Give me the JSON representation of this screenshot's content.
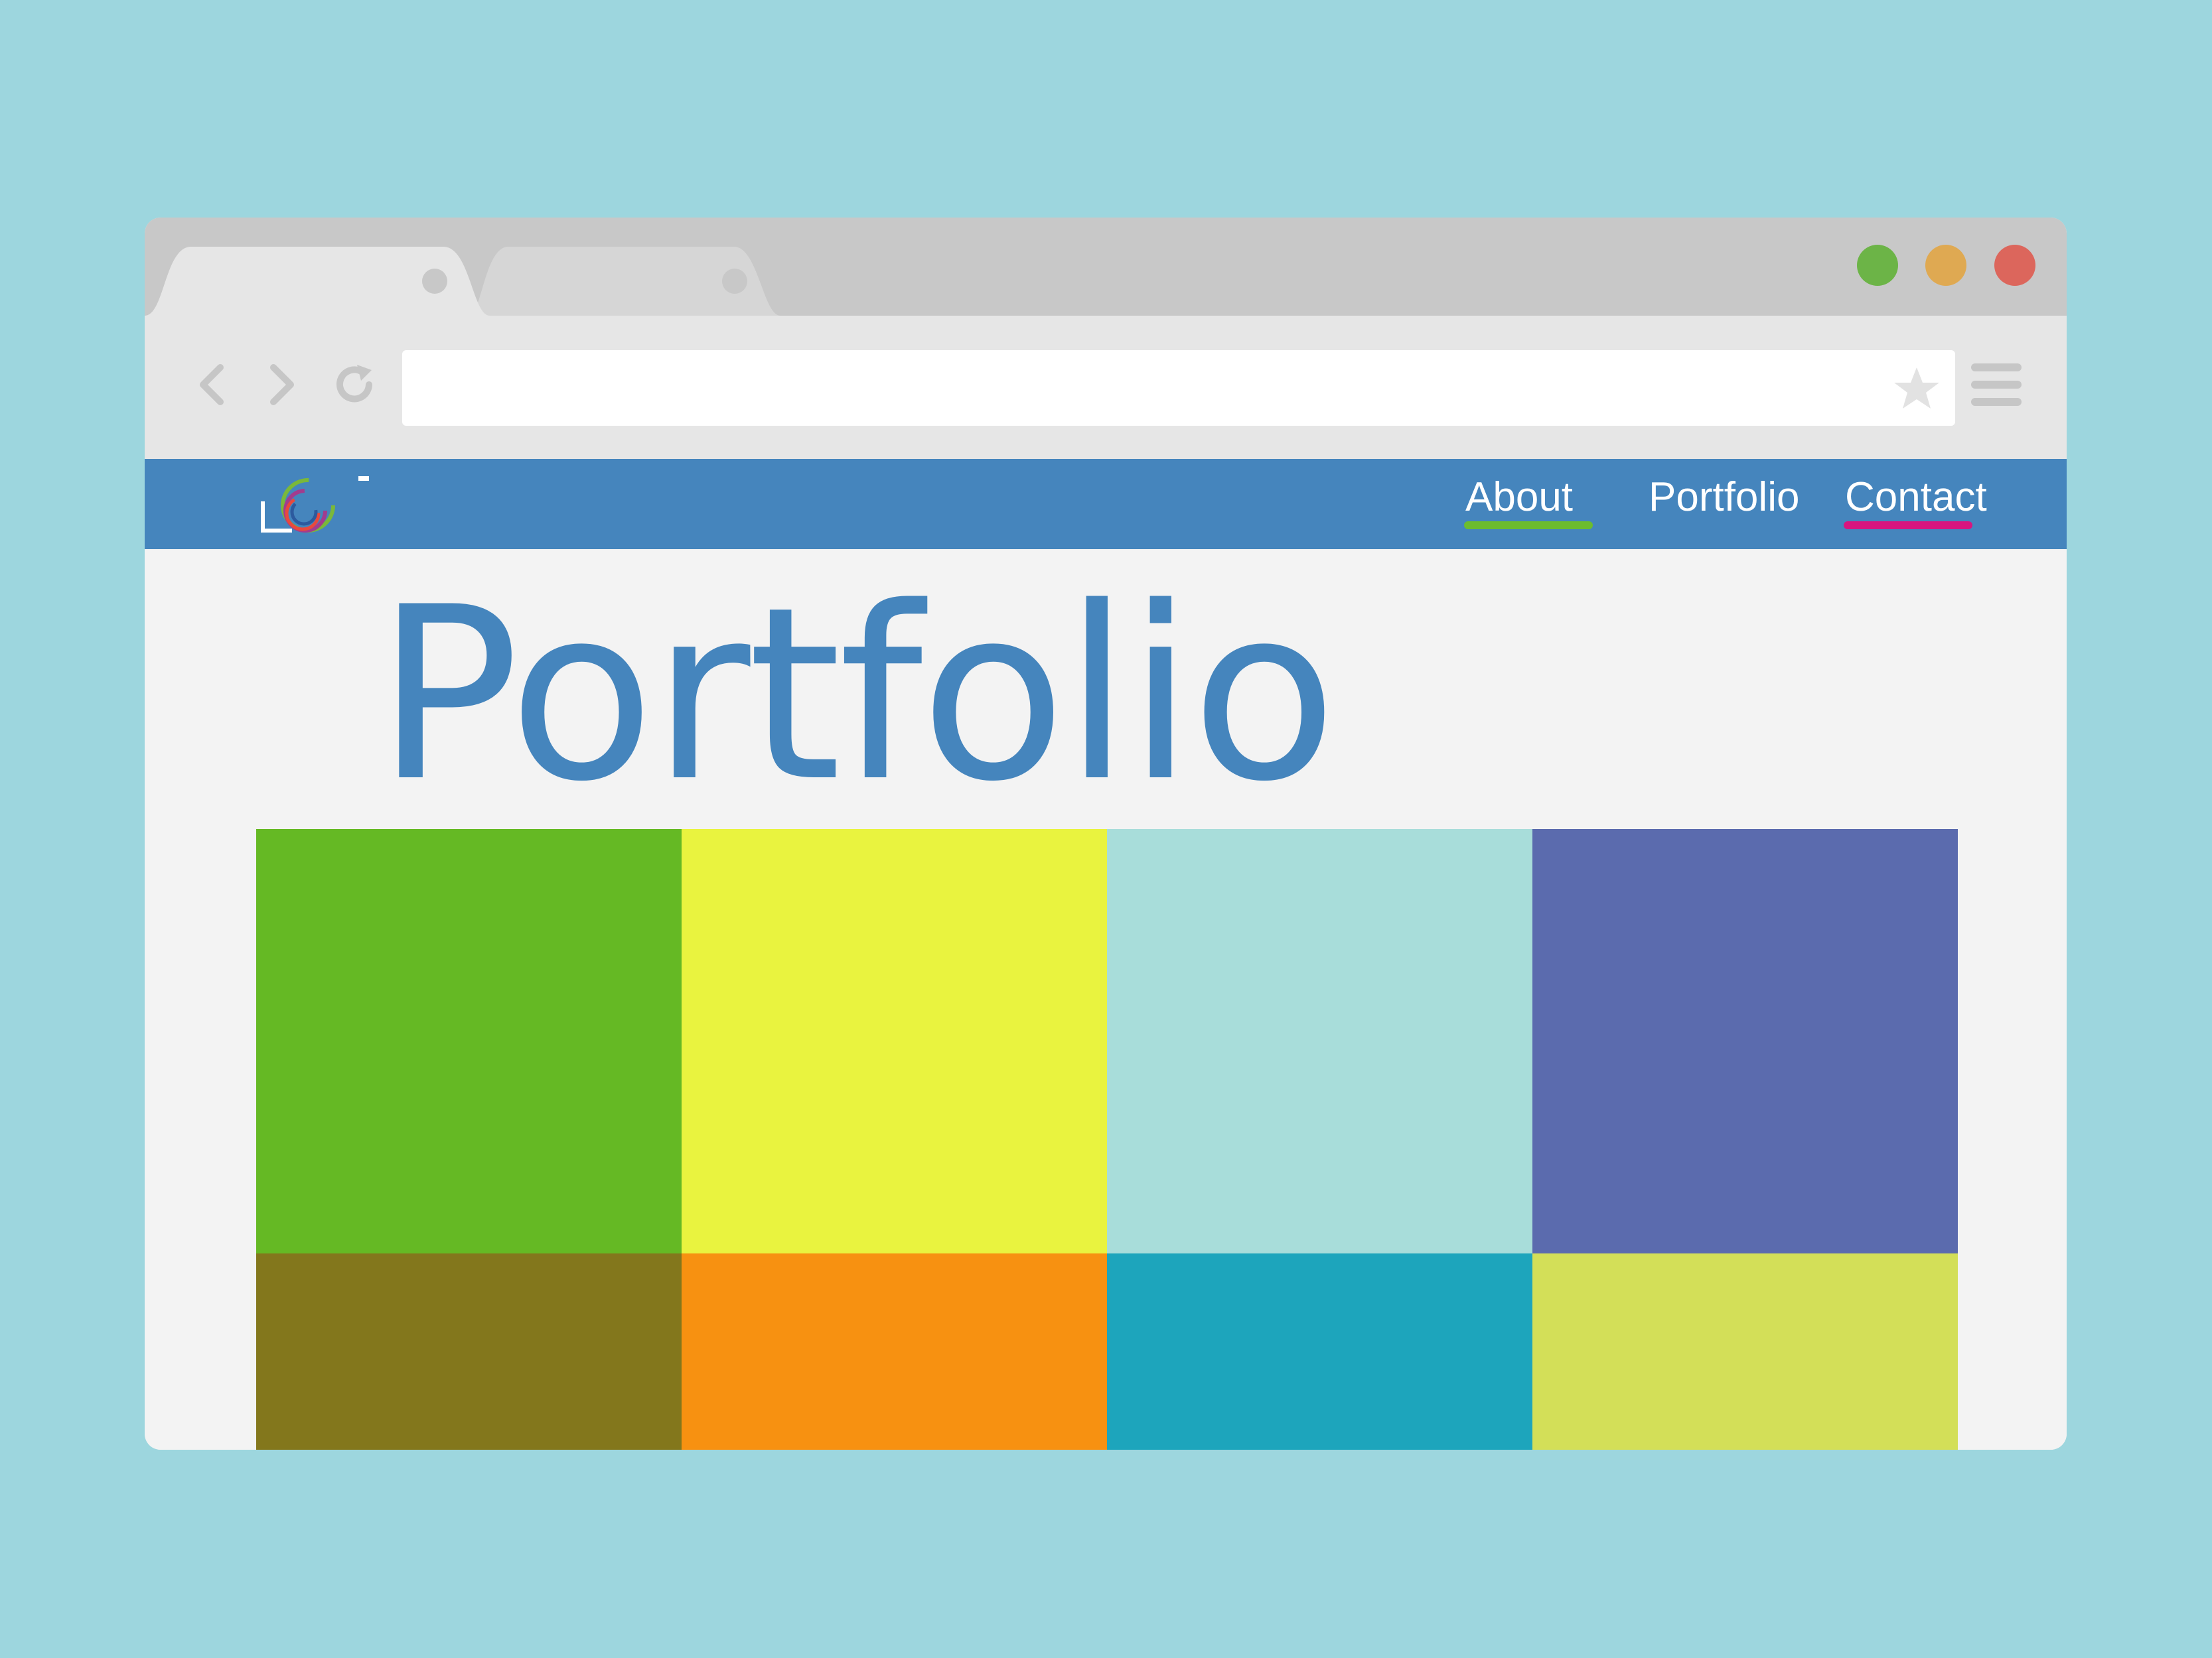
{
  "browser": {
    "tabs": [
      {
        "label": "",
        "active": true
      },
      {
        "label": "",
        "active": false
      }
    ],
    "window_controls": {
      "green": "#6cb447",
      "yellow": "#dfa952",
      "red": "#dc665c"
    },
    "toolbar": {
      "back_icon": "chevron-left-icon",
      "forward_icon": "chevron-right-icon",
      "reload_icon": "reload-icon",
      "address_value": "",
      "bookmark_icon": "star-icon",
      "menu_icon": "hamburger-menu-icon"
    }
  },
  "site": {
    "nav": {
      "background": "#4585bd",
      "items": [
        {
          "label": "About",
          "underline_color": "#6cbc2e"
        },
        {
          "label": "Portfolio",
          "underline_color": null
        },
        {
          "label": "Contact",
          "underline_color": "#d8157f"
        }
      ]
    },
    "page_title": "Portfolio",
    "tiles": [
      {
        "color": "#65b924"
      },
      {
        "color": "#e9f33f"
      },
      {
        "color": "#a8ddda"
      },
      {
        "color": "#5b6bae"
      },
      {
        "color": "#83771c"
      },
      {
        "color": "#f79111"
      },
      {
        "color": "#1da5bc"
      },
      {
        "color": "#d3df58"
      }
    ]
  }
}
